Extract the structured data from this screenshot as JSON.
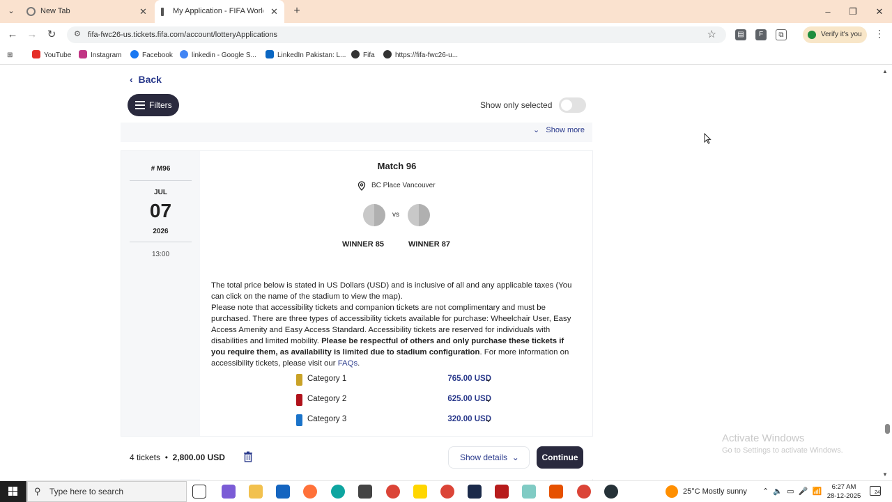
{
  "browser": {
    "tabs": [
      {
        "title": "New Tab",
        "active": false
      },
      {
        "title": "My Application - FIFA World Cu",
        "active": true
      }
    ],
    "url": "fifa-fwc26-us.tickets.fifa.com/account/lotteryApplications",
    "verify_label": "Verify it's you",
    "bookmarks": [
      {
        "label": "YouTube",
        "icon": "youtube-icon",
        "color": "#e52d27"
      },
      {
        "label": "Instagram",
        "icon": "instagram-icon",
        "color": "#c13584"
      },
      {
        "label": "Facebook",
        "icon": "facebook-icon",
        "color": "#1877f2"
      },
      {
        "label": "linkedin - Google S...",
        "icon": "google-icon",
        "color": "#4285f4"
      },
      {
        "label": "LinkedIn Pakistan: L...",
        "icon": "linkedin-icon",
        "color": "#0a66c2"
      },
      {
        "label": "Fifa",
        "icon": "globe-icon",
        "color": "#333333"
      },
      {
        "label": "https://fifa-fwc26-u...",
        "icon": "globe-icon",
        "color": "#333333"
      }
    ]
  },
  "page": {
    "back_label": "Back",
    "filters_label": "Filters",
    "show_only_selected_label": "Show only selected",
    "show_only_selected_on": false,
    "show_more_label": "Show more",
    "match": {
      "id": "# M96",
      "month": "JUL",
      "day": "07",
      "year": "2026",
      "time": "13:00",
      "title": "Match 96",
      "venue": "BC Place Vancouver",
      "vs": "vs",
      "home": "WINNER 85",
      "away": "WINNER 87"
    },
    "desc_p1": "The total price below is stated in US Dollars (USD) and is inclusive of all and any applicable taxes (You can click on the name of the stadium to view the map).",
    "desc_p2a": "Please note that accessibility tickets and companion tickets are not complimentary and must be purchased. There are three types of accessibility tickets available for purchase: Wheelchair User, Easy Access Amenity and Easy Access Standard. Accessibility tickets are reserved for individuals with disabilities and limited mobility. ",
    "desc_p2b": "Please be respectful of others and only purchase these tickets if you require them, as availability is limited due to stadium configuration",
    "desc_p2c": ". For more information on accessibility tickets, please visit our ",
    "faq_label": "FAQs",
    "desc_p2d": ".",
    "categories": [
      {
        "label": "Category 1",
        "price": "765.00 USD",
        "color": "#c9a227"
      },
      {
        "label": "Category 2",
        "price": "625.00 USD",
        "color": "#b0121b"
      },
      {
        "label": "Category 3",
        "price": "320.00 USD",
        "color": "#1a73c9"
      }
    ],
    "footer": {
      "tickets": "4 tickets",
      "sep": "•",
      "total": "2,800.00 USD",
      "show_details_label": "Show details",
      "continue_label": "Continue"
    },
    "watermark_title": "Activate Windows",
    "watermark_sub": "Go to Settings to activate Windows."
  },
  "taskbar": {
    "search_placeholder": "Type here to search",
    "weather": "25°C  Mostly sunny",
    "time": "6:27 AM",
    "date": "28-12-2025",
    "notif_count": "24"
  }
}
